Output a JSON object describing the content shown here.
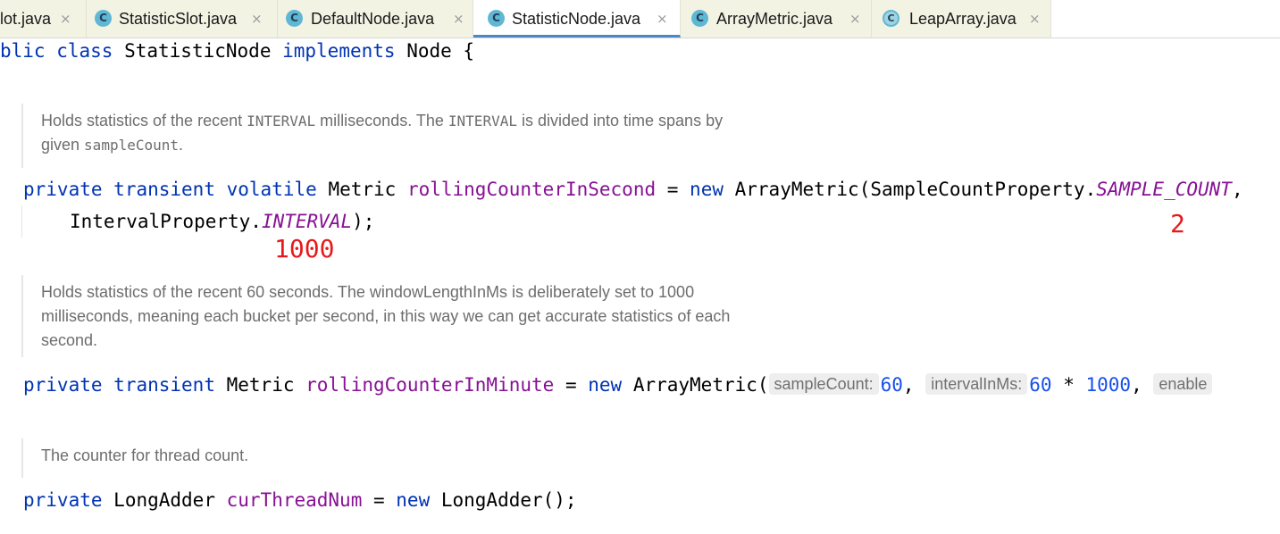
{
  "tabs": [
    {
      "label": "lot.java",
      "icon": "none",
      "active": false
    },
    {
      "label": "StatisticSlot.java",
      "icon": "C",
      "active": false
    },
    {
      "label": "DefaultNode.java",
      "icon": "C",
      "active": false
    },
    {
      "label": "StatisticNode.java",
      "icon": "C",
      "active": true
    },
    {
      "label": "ArrayMetric.java",
      "icon": "C",
      "active": false
    },
    {
      "label": "LeapArray.java",
      "icon": "C",
      "active": false
    }
  ],
  "close_glyph": "×",
  "code": {
    "line1": {
      "t1": "blic",
      "t2": " ",
      "t3": "class",
      "t4": " StatisticNode ",
      "t5": "implements",
      "t6": " Node {"
    },
    "doc1": {
      "l1a": "Holds statistics of the recent ",
      "l1b": "INTERVAL",
      "l1c": " milliseconds. The ",
      "l1d": "INTERVAL",
      "l1e": " is divided into time spans by",
      "l2a": "given ",
      "l2b": "sampleCount",
      "l2c": "."
    },
    "field1": {
      "k1": "private",
      "k2": "transient",
      "k3": "volatile",
      "type": "Metric",
      "name": "rollingCounterInSecond",
      "eq": " = ",
      "k4": "new",
      "call": " ArrayMetric(SampleCountProperty.",
      "const1": "SAMPLE_COUNT",
      "comma": ",",
      "l2a": "IntervalProperty.",
      "const2": "INTERVAL",
      "l2b": ");"
    },
    "doc2": {
      "l1": "Holds statistics of the recent 60 seconds. The windowLengthInMs is deliberately set to 1000",
      "l2": "milliseconds, meaning each bucket per second, in this way we can get accurate statistics of each",
      "l3": "second."
    },
    "field2": {
      "k1": "private",
      "k2": "transient",
      "type": "Metric",
      "name": "rollingCounterInMinute",
      "eq": " = ",
      "k3": "new",
      "call": " ArrayMetric(",
      "hint1": "sampleCount:",
      "v1": "60",
      "sep1": ",",
      "hint2": "intervalInMs:",
      "v2": "60",
      "op": " * ",
      "v3": "1000",
      "sep2": ",",
      "hint3": "enable"
    },
    "doc3": {
      "l1": "The counter for thread count."
    },
    "field3": {
      "k1": "private",
      "type": "LongAdder",
      "name": "curThreadNum",
      "eq": " = ",
      "k2": "new",
      "call": " LongAdder();"
    }
  },
  "annotations": {
    "a1": "1000",
    "a2": "2"
  },
  "colors": {
    "keyword": "#0033b3",
    "field": "#871094",
    "number": "#1750eb",
    "annotation": "#e8191b",
    "active_tab_underline": "#4a88c7",
    "tab_background": "#f2f3e3"
  }
}
